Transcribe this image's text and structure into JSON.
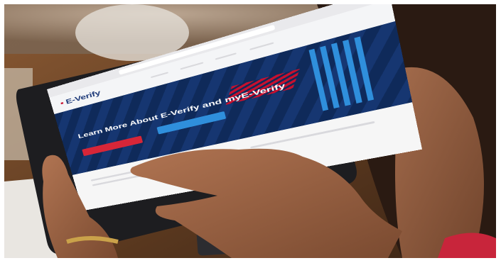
{
  "scene": {
    "subject": "hand-pointing-at-tablet",
    "device": "tablet",
    "screen": {
      "logo_text": "E-Verify",
      "headline": "Learn More About E-Verify and myE-Verify"
    },
    "colors": {
      "navy": "#0f2a5a",
      "brand_red": "#d72638",
      "brand_blue": "#2f8fdc",
      "wood": "#5a3a22"
    },
    "icons": [
      "flag-icon"
    ]
  }
}
